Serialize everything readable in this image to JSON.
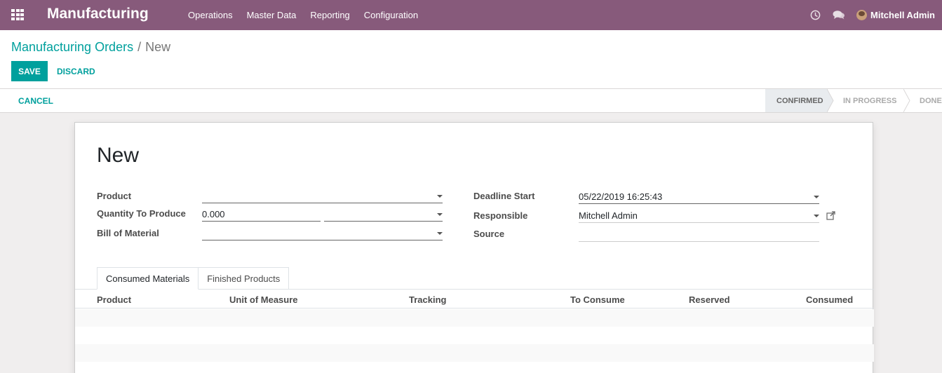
{
  "navbar": {
    "brand": "Manufacturing",
    "menu": [
      "Operations",
      "Master Data",
      "Reporting",
      "Configuration"
    ],
    "user": "Mitchell Admin"
  },
  "breadcrumb": {
    "parent": "Manufacturing Orders",
    "separator": "/",
    "current": "New"
  },
  "buttons": {
    "save": "SAVE",
    "discard": "DISCARD",
    "cancel": "CANCEL"
  },
  "stages": [
    "CONFIRMED",
    "IN PROGRESS",
    "DONE"
  ],
  "form": {
    "title": "New",
    "product_label": "Product",
    "product_value": "",
    "qty_label": "Quantity To Produce",
    "qty_value": "0.000",
    "uom_value": "",
    "bom_label": "Bill of Material",
    "bom_value": "",
    "deadline_label": "Deadline Start",
    "deadline_value": "05/22/2019 16:25:43",
    "responsible_label": "Responsible",
    "responsible_value": "Mitchell Admin",
    "source_label": "Source",
    "source_value": ""
  },
  "tabs": [
    "Consumed Materials",
    "Finished Products"
  ],
  "table": {
    "columns": [
      "Product",
      "Unit of Measure",
      "Tracking",
      "To Consume",
      "Reserved",
      "Consumed"
    ]
  },
  "colors": {
    "brand": "#875a7b",
    "accent": "#00a09d"
  }
}
